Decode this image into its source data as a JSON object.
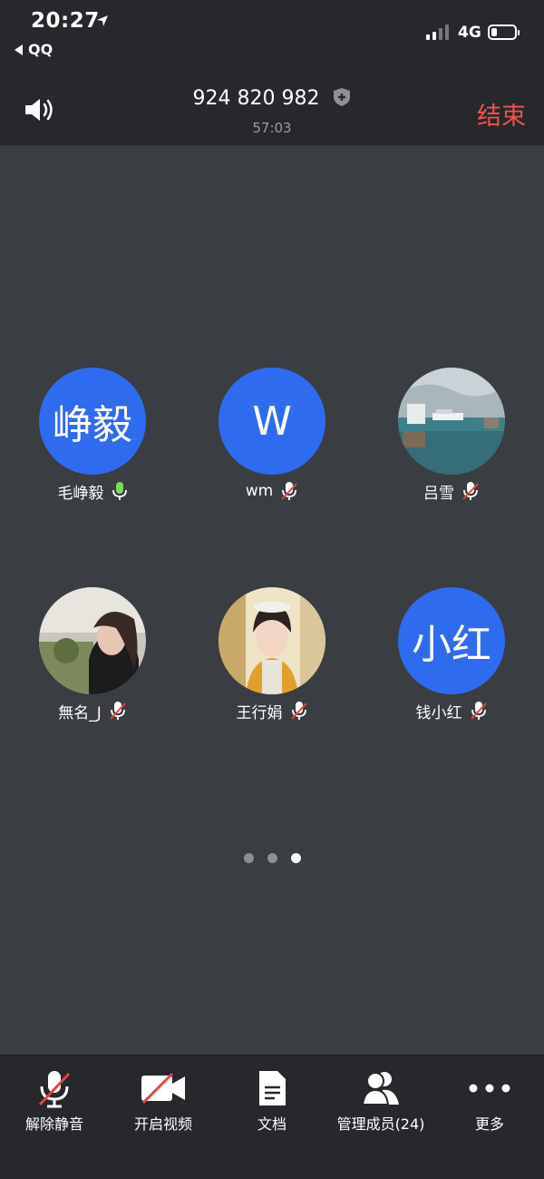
{
  "status_bar": {
    "time": "20:27",
    "back_app": "QQ",
    "network": "4G"
  },
  "header": {
    "meeting_id": "924 820 982",
    "duration": "57:03",
    "end_label": "结束"
  },
  "participants": [
    {
      "name": "毛峥毅",
      "avatar_text": "峥毅",
      "mic": "on"
    },
    {
      "name": "wm",
      "avatar_text": "W",
      "mic": "muted"
    },
    {
      "name": "吕雪",
      "avatar_text": "",
      "mic": "muted"
    },
    {
      "name": "無名_J",
      "avatar_text": "",
      "mic": "muted"
    },
    {
      "name": "王行娟",
      "avatar_text": "",
      "mic": "muted"
    },
    {
      "name": "钱小红",
      "avatar_text": "小红",
      "mic": "muted"
    }
  ],
  "pager": {
    "pages": 3,
    "active": 3
  },
  "toolbar": {
    "unmute": "解除静音",
    "start_video": "开启视频",
    "docs": "文档",
    "manage_members": "管理成员(24)",
    "more": "更多"
  },
  "colors": {
    "avatar_blue": "#2f6bef",
    "end_red": "#f0534d",
    "mic_on_green": "#7ed957",
    "mute_red": "#e0463f"
  }
}
